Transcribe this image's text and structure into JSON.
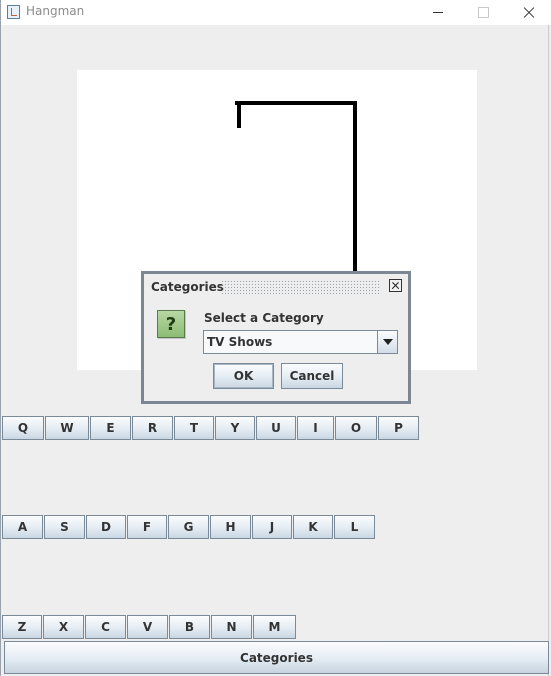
{
  "window": {
    "title": "Hangman",
    "icon": "java-cup-icon"
  },
  "keyboard": {
    "row1": [
      "Q",
      "W",
      "E",
      "R",
      "T",
      "Y",
      "U",
      "I",
      "O",
      "P"
    ],
    "row2": [
      "A",
      "S",
      "D",
      "F",
      "G",
      "H",
      "J",
      "K",
      "L"
    ],
    "row3": [
      "Z",
      "X",
      "C",
      "V",
      "B",
      "N",
      "M"
    ]
  },
  "categories_button": "Categories",
  "dialog": {
    "title": "Categories",
    "prompt": "Select a Category",
    "selected": "TV Shows",
    "ok": "OK",
    "cancel": "Cancel",
    "icon": "question-icon",
    "icon_glyph": "?"
  }
}
